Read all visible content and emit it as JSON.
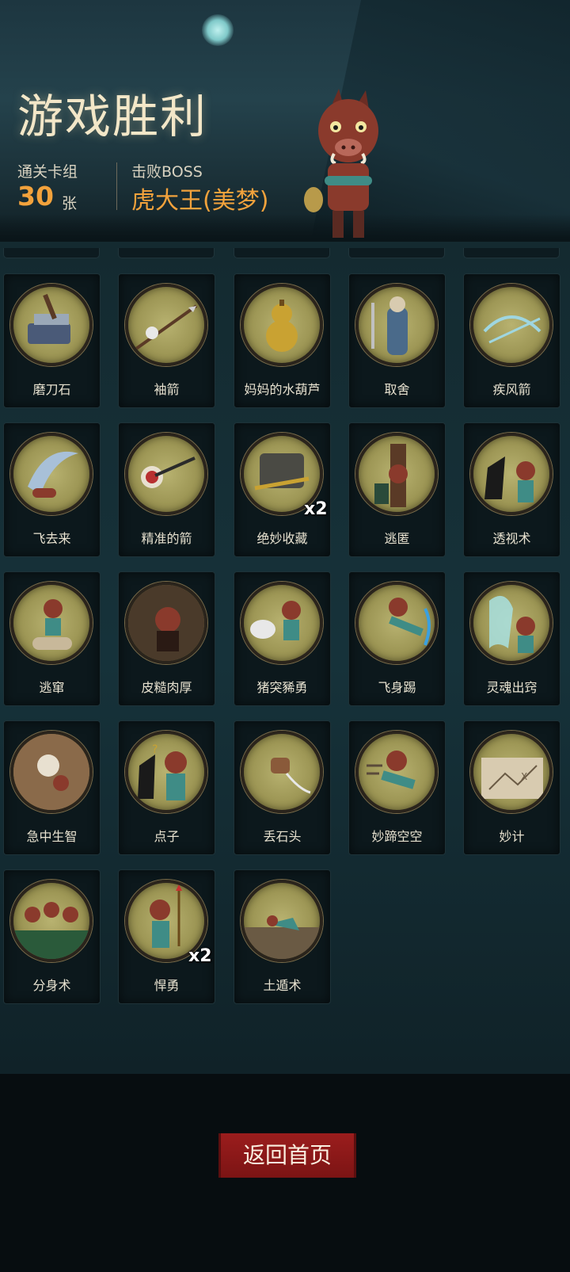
{
  "header": {
    "title": "游戏胜利",
    "cleared_deck_label": "通关卡组",
    "cleared_count": "30",
    "cleared_unit": "张",
    "boss_label": "击败BOSS",
    "boss_name": "虎大王(美梦)"
  },
  "cards": [
    {
      "name": "磨刀石",
      "icon": "whetstone-icon"
    },
    {
      "name": "袖箭",
      "icon": "sleeve-arrow-icon"
    },
    {
      "name": "妈妈的水葫芦",
      "icon": "gourd-icon"
    },
    {
      "name": "取舍",
      "icon": "elder-sword-icon"
    },
    {
      "name": "疾风箭",
      "icon": "gale-arrow-icon"
    },
    {
      "name": "飞去来",
      "icon": "boomerang-icon"
    },
    {
      "name": "精准的箭",
      "icon": "target-arrow-icon"
    },
    {
      "name": "绝妙收藏",
      "icon": "collection-icon",
      "badge": "x2"
    },
    {
      "name": "逃匿",
      "icon": "hide-icon"
    },
    {
      "name": "透视术",
      "icon": "crow-boar-icon"
    },
    {
      "name": "逃窜",
      "icon": "flee-icon"
    },
    {
      "name": "皮糙肉厚",
      "icon": "tough-skin-icon"
    },
    {
      "name": "猪突豨勇",
      "icon": "charge-icon"
    },
    {
      "name": "飞身踢",
      "icon": "flying-kick-icon"
    },
    {
      "name": "灵魂出窍",
      "icon": "ghost-icon"
    },
    {
      "name": "急中生智",
      "icon": "quick-wit-icon"
    },
    {
      "name": "点子",
      "icon": "idea-icon"
    },
    {
      "name": "丢石头",
      "icon": "stone-icon"
    },
    {
      "name": "妙蹄空空",
      "icon": "hoof-icon"
    },
    {
      "name": "妙计",
      "icon": "map-icon"
    },
    {
      "name": "分身术",
      "icon": "clone-icon"
    },
    {
      "name": "悍勇",
      "icon": "brave-icon",
      "badge": "x2"
    },
    {
      "name": "土遁术",
      "icon": "earth-escape-icon"
    }
  ],
  "footer": {
    "home_button_label": "返回首页"
  }
}
